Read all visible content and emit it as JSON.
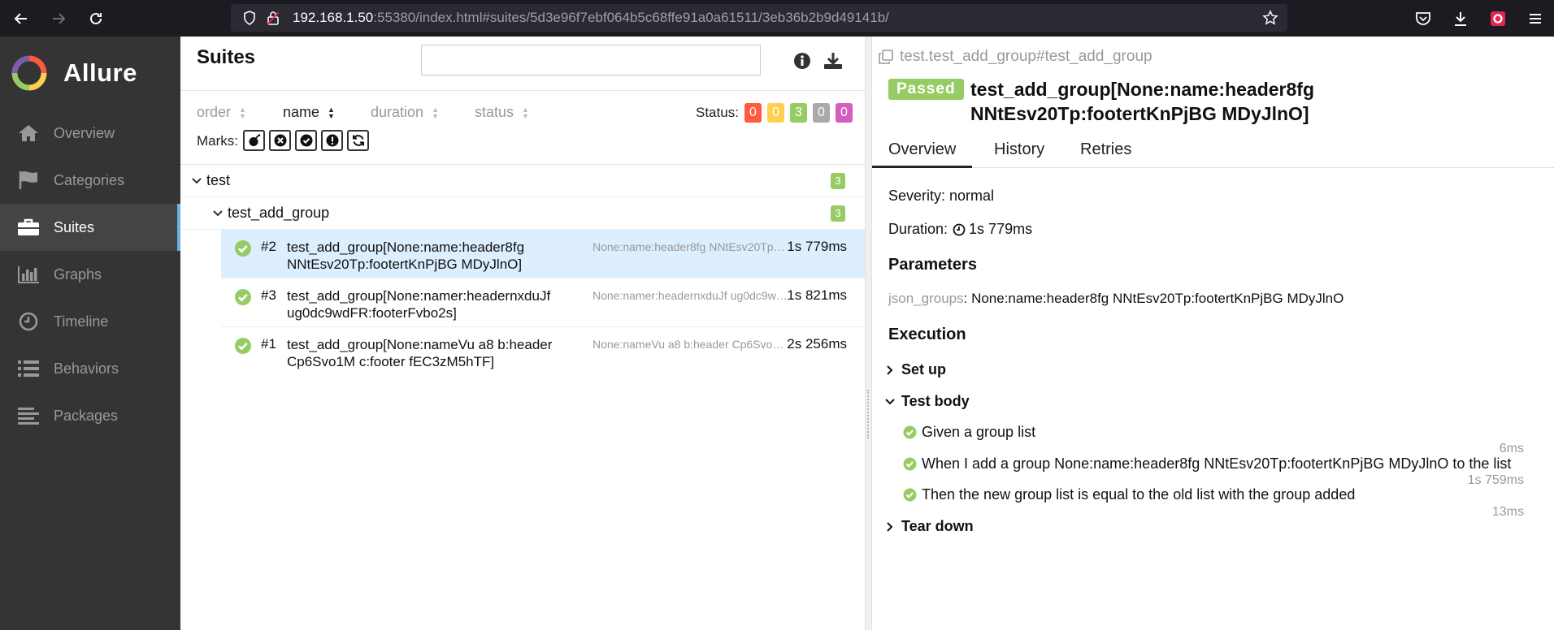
{
  "browser": {
    "url_host": "192.168.1.50",
    "url_rest": ":55380/index.html#suites/5d3e96f7ebf064b5c68ffe91a0a61511/3eb36b2b9d49141b/"
  },
  "sidebar": {
    "brand": "Allure",
    "items": [
      {
        "label": "Overview",
        "icon": "home-icon"
      },
      {
        "label": "Categories",
        "icon": "flag-icon"
      },
      {
        "label": "Suites",
        "icon": "briefcase-icon"
      },
      {
        "label": "Graphs",
        "icon": "bar-chart-icon"
      },
      {
        "label": "Timeline",
        "icon": "clock-icon"
      },
      {
        "label": "Behaviors",
        "icon": "list-icon"
      },
      {
        "label": "Packages",
        "icon": "align-left-icon"
      }
    ],
    "active_index": 2
  },
  "suites": {
    "title": "Suites",
    "search_value": "",
    "sort": [
      "order",
      "name",
      "duration",
      "status"
    ],
    "status_label": "Status:",
    "status_counts": [
      {
        "value": "0",
        "color": "#fd5a3e"
      },
      {
        "value": "0",
        "color": "#ffd050"
      },
      {
        "value": "3",
        "color": "#97cc64"
      },
      {
        "value": "0",
        "color": "#aaaaaa"
      },
      {
        "value": "0",
        "color": "#d35ebe"
      }
    ],
    "marks_label": "Marks:",
    "tree": {
      "root": {
        "name": "test",
        "count": "3"
      },
      "child": {
        "name": "test_add_group",
        "count": "3"
      },
      "tests": [
        {
          "num": "#2",
          "name": "test_add_group[None:name:header8fg NNtEsv20Tp:footertKnPjBG MDyJlnO]",
          "param": "None:name:header8fg NNtEsv20Tp:footertKnPjBG MDyJlnO",
          "duration": "1s 779ms"
        },
        {
          "num": "#3",
          "name": "test_add_group[None:namer:headernxduJf ug0dc9wdFR:footerFvbo2s]",
          "param": "None:namer:headernxduJf ug0dc9wdFR:footerFvbo2s",
          "duration": "1s 821ms"
        },
        {
          "num": "#1",
          "name": "test_add_group[None:nameVu a8 b:header Cp6Svo1M c:footer fEC3zM5hTF]",
          "param": "None:nameVu a8 b:header Cp6Svo1M c:footer fEC3zM5hTF",
          "duration": "2s 256ms"
        }
      ]
    }
  },
  "details": {
    "path": "test.test_add_group#test_add_group",
    "status": "Passed",
    "title": "test_add_group[None:name:header8fg NNtEsv20Tp:footertKnPjBG MDyJlnO]",
    "tabs": [
      "Overview",
      "History",
      "Retries"
    ],
    "severity": "Severity: normal",
    "duration_label": "Duration:",
    "duration_value": "1s 779ms",
    "parameters_heading": "Parameters",
    "param_key": "json_groups",
    "param_value": ": None:name:header8fg NNtEsv20Tp:footertKnPjBG MDyJlnO",
    "execution_heading": "Execution",
    "setup": "Set up",
    "test_body": "Test body",
    "steps": [
      {
        "text": "Given a group list",
        "duration": "6ms"
      },
      {
        "text": "When I add a group None:name:header8fg NNtEsv20Tp:footertKnPjBG MDyJlnO to the list",
        "duration": "1s 759ms"
      },
      {
        "text": "Then the new group list is equal to the old list with the group added",
        "duration": "13ms"
      }
    ],
    "teardown": "Tear down"
  }
}
